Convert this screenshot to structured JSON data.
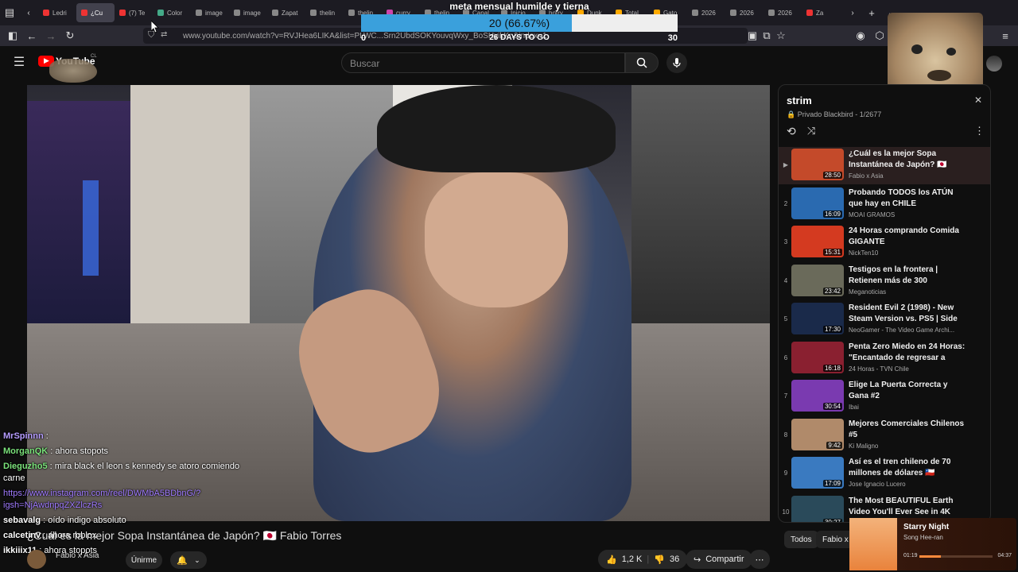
{
  "browser": {
    "tabs": [
      "Ledri",
      "¿Cu",
      "(7) Te",
      "Color",
      "image",
      "image",
      "Zapat",
      "thelin",
      "thelin",
      "curry",
      "thelin",
      "Canal",
      "Inicio",
      "hotry",
      "Dunk",
      "Total",
      "Gato",
      "2026",
      "2026",
      "2026",
      "Za"
    ],
    "url": "www.youtube.com/watch?v=RVJHea6LIKA&list=PLWC...Srn2UbdSOKYouvqWxy_BoSHyikKn&index=1"
  },
  "goal": {
    "title": "meta mensual humilde y tierna",
    "percent_text": "20 (66.67%)",
    "progress": 0.6667,
    "min": "0",
    "max": "30",
    "days_text": "26 DAYS TO GO"
  },
  "youtube": {
    "logo_text": "YouTube",
    "logo_suffix": "CL",
    "search_placeholder": "Buscar"
  },
  "video": {
    "title": "¿Cuál es la mejor Sopa Instantánea de Japón? 🇯🇵 Fabio Torres",
    "channel": "Fabio x Asia",
    "subscribe_label": "Únirme",
    "likes": "1,2 K",
    "dislikes": "36",
    "share_label": "Compartir"
  },
  "chat": [
    {
      "user": "MrSpinnn",
      "text": "",
      "color": "#b59cff"
    },
    {
      "user": "MorganQK",
      "text": "ahora stopots",
      "color": "#7be37b"
    },
    {
      "user": "Dieguzho5",
      "text": "mira black el leon s kennedy se atoro comiendo carne",
      "color": "#7be37b"
    },
    {
      "user": "",
      "text": "https://www.instagram.com/reel/DWMbA5BDbnG/?igsh=NjAwdnpqZXZlczRs",
      "color": "#a07bff"
    },
    {
      "user": "sebavalg",
      "text": "oído indigo absoluto",
      "color": "#ffffff"
    },
    {
      "user": "calcetinv",
      "text": "ahora roblox",
      "color": "#ffffff"
    },
    {
      "user": "ikkiiix11",
      "text": "ahora stopots",
      "color": "#ffffff"
    }
  ],
  "playlist": {
    "title": "strim",
    "subtitle": "Privado Blackbird - 1/2677",
    "items": [
      {
        "num": "▶",
        "title": "¿Cuál es la mejor Sopa Instantánea de Japón? 🇯🇵 Fabio...",
        "channel": "Fabio x Asia",
        "duration": "28:50",
        "thumb": "#c44a2a"
      },
      {
        "num": "2",
        "title": "Probando TODOS los ATÚN que hay en CHILE",
        "channel": "MOAI GRAMOS",
        "duration": "16:09",
        "thumb": "#2a6ab0"
      },
      {
        "num": "3",
        "title": "24 Horas comprando Comida GIGANTE",
        "channel": "NickTen10",
        "duration": "15:31",
        "thumb": "#d43a20"
      },
      {
        "num": "4",
        "title": "Testigos en la frontera | Retienen más de 300 potenciadores...",
        "channel": "Meganoticias",
        "duration": "23:42",
        "thumb": "#6a6a5a"
      },
      {
        "num": "5",
        "title": "Resident Evil 2 (1998) - New Steam Version vs. PS5 | Side by...",
        "channel": "NeoGamer - The Video Game Archi...",
        "duration": "17:30",
        "thumb": "#1a2a4a"
      },
      {
        "num": "6",
        "title": "Penta Zero Miedo en 24 Horas: \"Encantado de regresar a Chile...",
        "channel": "24 Horas - TVN Chile",
        "duration": "16:18",
        "thumb": "#8a2030"
      },
      {
        "num": "7",
        "title": "Elige La Puerta Correcta y Gana #2",
        "channel": "Ibai",
        "duration": "30:54",
        "thumb": "#7a3ab0"
      },
      {
        "num": "8",
        "title": "Mejores Comerciales Chilenos #5",
        "channel": "Ki Maligno",
        "duration": "9:42",
        "thumb": "#b08a6a"
      },
      {
        "num": "9",
        "title": "Así es el tren chileno de 70 millones de dólares 🇨🇱",
        "channel": "Jose Ignacio Lucero",
        "duration": "17:09",
        "thumb": "#3a7ac0"
      },
      {
        "num": "10",
        "title": "The Most BEAUTIFUL Earth Video You'll Ever See in 4K HDR 60 FPS",
        "channel": "",
        "duration": "30:27",
        "thumb": "#2a4a5a"
      }
    ]
  },
  "chips": [
    "Todos",
    "Fabio x A"
  ],
  "now_playing": {
    "title": "Starry Night",
    "artist": "Song Hee-ran",
    "elapsed": "01:19",
    "total": "04:37",
    "progress": 0.29
  }
}
